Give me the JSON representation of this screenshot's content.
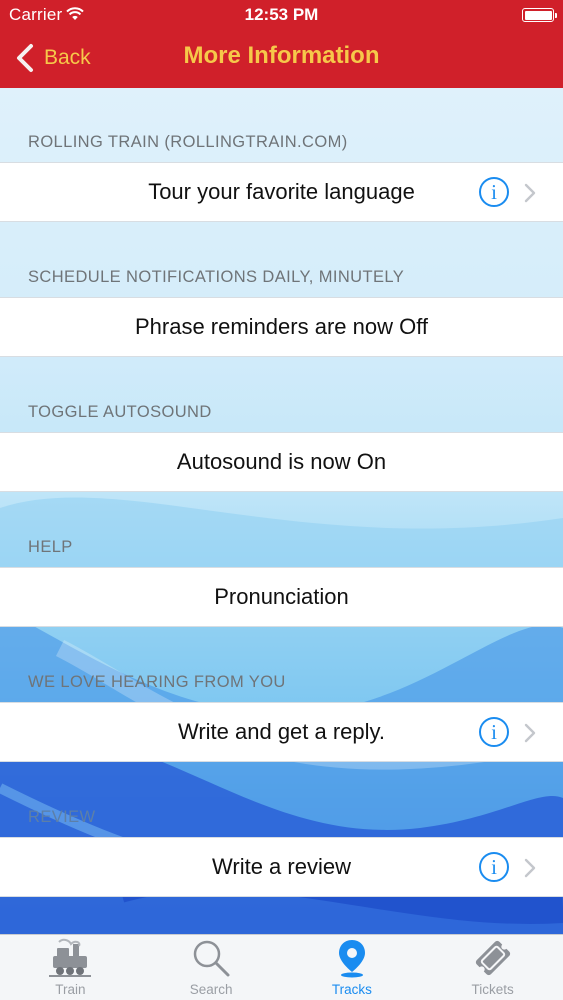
{
  "status_bar": {
    "carrier": "Carrier",
    "time": "12:53 PM"
  },
  "nav": {
    "back_label": "Back",
    "title": "More Information"
  },
  "sections": [
    {
      "header": "ROLLING TRAIN (ROLLINGTRAIN.COM)",
      "cell": "Tour your favorite language",
      "has_info": true,
      "has_disclosure": true
    },
    {
      "header": "SCHEDULE NOTIFICATIONS DAILY, MINUTELY",
      "cell": "Phrase reminders are now Off",
      "has_info": false,
      "has_disclosure": false
    },
    {
      "header": "TOGGLE AUTOSOUND",
      "cell": "Autosound is now On",
      "has_info": false,
      "has_disclosure": false
    },
    {
      "header": "HELP",
      "cell": "Pronunciation",
      "has_info": false,
      "has_disclosure": false
    },
    {
      "header": "WE LOVE HEARING FROM YOU",
      "cell": "Write and get a reply.",
      "has_info": true,
      "has_disclosure": true
    },
    {
      "header": "REVIEW",
      "cell": "Write a review",
      "has_info": true,
      "has_disclosure": true
    }
  ],
  "tabs": [
    {
      "label": "Train",
      "icon": "train-icon",
      "active": false
    },
    {
      "label": "Search",
      "icon": "search-icon",
      "active": false
    },
    {
      "label": "Tracks",
      "icon": "location-pin-icon",
      "active": true
    },
    {
      "label": "Tickets",
      "icon": "ticket-icon",
      "active": false
    }
  ],
  "colors": {
    "header_bg": "#d0202a",
    "nav_text": "#f6c84a",
    "accent": "#1a8cf0"
  }
}
